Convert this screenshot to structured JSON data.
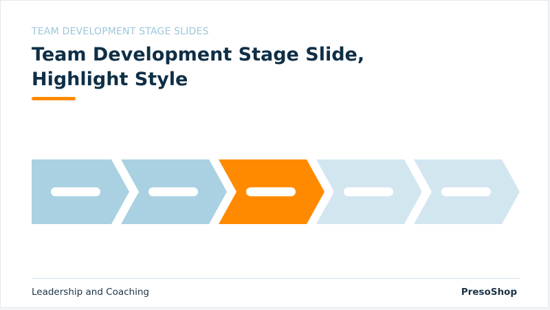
{
  "slide": {
    "supertitle": "TEAM DEVELOPMENT STAGE SLIDES",
    "title_line1": "Team Development Stage Slide,",
    "title_line2": "Highlight Style",
    "footer_left": "Leadership and Coaching",
    "footer_right": "PresoShop"
  },
  "stages": [
    {
      "state": "normal"
    },
    {
      "state": "normal"
    },
    {
      "state": "highlighted"
    },
    {
      "state": "faded"
    },
    {
      "state": "faded"
    }
  ],
  "colors": {
    "accent": "#ff8a00",
    "normal": "#a9d1e2",
    "faded": "#d2e6f0",
    "title": "#0f2f46",
    "supertitle": "#9dc6da"
  }
}
